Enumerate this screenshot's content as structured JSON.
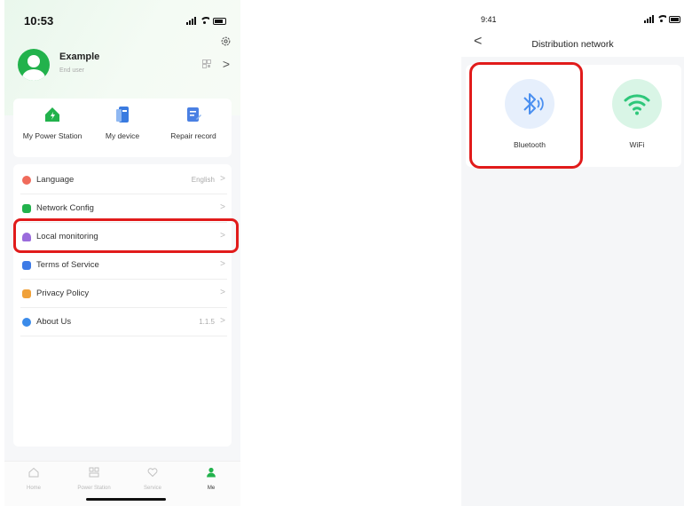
{
  "left": {
    "status": {
      "time": "10:53"
    },
    "profile": {
      "name": "Example",
      "role": "End user"
    },
    "quick_actions": [
      {
        "label": "My Power Station",
        "icon": "power-station-icon",
        "color": "#22b24c"
      },
      {
        "label": "My device",
        "icon": "device-icon",
        "color": "#3a7be0"
      },
      {
        "label": "Repair record",
        "icon": "repair-record-icon",
        "color": "#4a80e3"
      }
    ],
    "menu": [
      {
        "label": "Language",
        "value": "English",
        "icon": "language-icon",
        "color": "#f06b5b"
      },
      {
        "label": "Network Config",
        "value": "",
        "icon": "network-config-icon",
        "color": "#22b24c"
      },
      {
        "label": "Local monitoring",
        "value": "",
        "icon": "local-monitoring-icon",
        "color": "#9a6bdc"
      },
      {
        "label": "Terms of Service",
        "value": "",
        "icon": "terms-icon",
        "color": "#3e7be6"
      },
      {
        "label": "Privacy Policy",
        "value": "",
        "icon": "privacy-icon",
        "color": "#f0a13a"
      },
      {
        "label": "About Us",
        "value": "1.1.5",
        "icon": "about-icon",
        "color": "#3b8bea"
      }
    ],
    "tabs": [
      {
        "label": "Home",
        "icon": "home-icon",
        "active": false
      },
      {
        "label": "Power Station",
        "icon": "power-station-tab-icon",
        "active": false
      },
      {
        "label": "Service",
        "icon": "service-icon",
        "active": false
      },
      {
        "label": "Me",
        "icon": "me-icon",
        "active": true
      }
    ],
    "accent": "#22b24c",
    "highlight_color": "#e11b1b"
  },
  "right": {
    "status": {
      "time": "9:41"
    },
    "title": "Distribution network",
    "options": [
      {
        "label": "Bluetooth",
        "icon": "bluetooth-icon",
        "color": "#4a8ff0"
      },
      {
        "label": "WiFi",
        "icon": "wifi-icon",
        "color": "#2ec77a"
      }
    ]
  }
}
